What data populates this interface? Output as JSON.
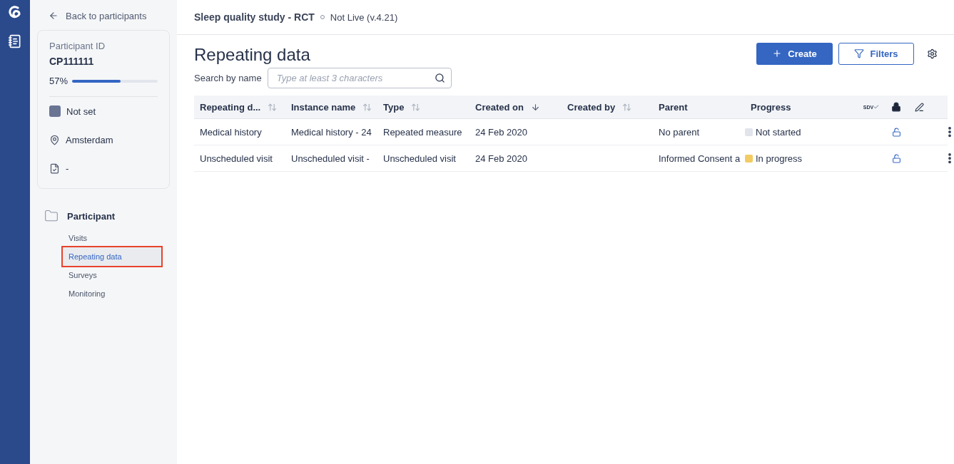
{
  "back_link": "Back to participants",
  "participant": {
    "id_label": "Participant ID",
    "id": "CP111111",
    "progress_text": "57%",
    "level": 0.57,
    "status": "Not set",
    "site": "Amsterdam",
    "note": "-"
  },
  "nav": {
    "section": "Participant",
    "items": [
      {
        "label": "Visits",
        "selected": false
      },
      {
        "label": "Repeating data",
        "selected": true
      },
      {
        "label": "Surveys",
        "selected": false
      },
      {
        "label": "Monitoring",
        "selected": false
      }
    ]
  },
  "header": {
    "study": "Sleep quality study - RCT",
    "status": "Not Live (v.4.21)"
  },
  "page": {
    "title": "Repeating data",
    "create_button": "Create",
    "filters_button": "Filters",
    "search_label": "Search by name",
    "search_placeholder": "Type at least 3 characters"
  },
  "table": {
    "columns": [
      {
        "label": "Repeating d...",
        "kind": "sortable"
      },
      {
        "label": "Instance name",
        "kind": "sortable"
      },
      {
        "label": "Type",
        "kind": "sortable"
      },
      {
        "label": "Created on",
        "kind": "sorted"
      },
      {
        "label": "Created by",
        "kind": "sortable"
      },
      {
        "label": "Parent",
        "kind": "plain"
      },
      {
        "label": "Progress",
        "kind": "plain"
      }
    ],
    "sdv_label": "SDV",
    "rows": [
      {
        "cells": [
          "Medical history",
          "Medical history - 24",
          "Repeated measure",
          "24 Feb 2020",
          "",
          "No parent"
        ],
        "progress": "Not started",
        "color": "#e1e4ea"
      },
      {
        "cells": [
          "Unscheduled visit",
          "Unscheduled visit -",
          "Unscheduled visit",
          "24 Feb 2020",
          "",
          "Informed Consent a"
        ],
        "progress": "In progress",
        "color": "#f2cb62"
      }
    ]
  }
}
